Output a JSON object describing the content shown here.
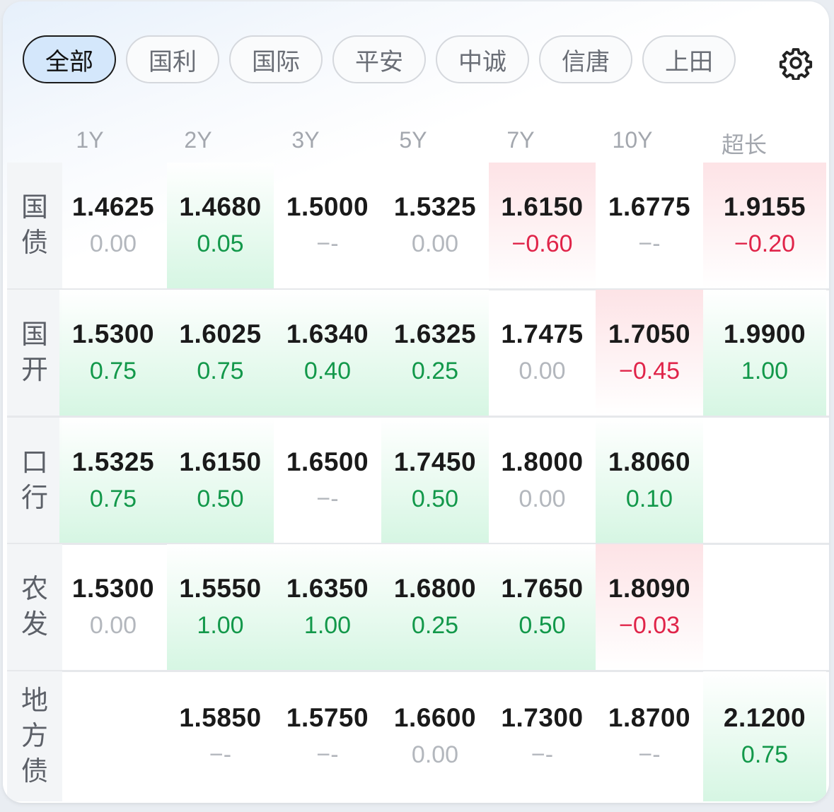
{
  "tabs": [
    {
      "label": "全部",
      "active": true,
      "name": "tab-all"
    },
    {
      "label": "国利",
      "active": false,
      "name": "tab-guoli"
    },
    {
      "label": "国际",
      "active": false,
      "name": "tab-guoji"
    },
    {
      "label": "平安",
      "active": false,
      "name": "tab-pingan"
    },
    {
      "label": "中诚",
      "active": false,
      "name": "tab-zhongcheng"
    },
    {
      "label": "信唐",
      "active": false,
      "name": "tab-xintang"
    },
    {
      "label": "上田",
      "active": false,
      "name": "tab-shangtian"
    }
  ],
  "settings_icon": "gear-icon",
  "columns": [
    "1Y",
    "2Y",
    "3Y",
    "5Y",
    "7Y",
    "10Y",
    "超长"
  ],
  "colors": {
    "up": "#12984a",
    "down": "#e02449",
    "flat": "#b3b7bd",
    "up_bg": "#d6f6e3",
    "down_bg": "#fde3e6"
  },
  "rows": [
    {
      "label": "国债",
      "cells": [
        {
          "yield": "1.4625",
          "change": "0.00",
          "dir": "flat"
        },
        {
          "yield": "1.4680",
          "change": "0.05",
          "dir": "up"
        },
        {
          "yield": "1.5000",
          "change": "--",
          "dir": "flat"
        },
        {
          "yield": "1.5325",
          "change": "0.00",
          "dir": "flat"
        },
        {
          "yield": "1.6150",
          "change": "-0.60",
          "dir": "down"
        },
        {
          "yield": "1.6775",
          "change": "--",
          "dir": "flat"
        },
        {
          "yield": "1.9155",
          "change": "-0.20",
          "dir": "down"
        }
      ]
    },
    {
      "label": "国开",
      "cells": [
        {
          "yield": "1.5300",
          "change": "0.75",
          "dir": "up"
        },
        {
          "yield": "1.6025",
          "change": "0.75",
          "dir": "up"
        },
        {
          "yield": "1.6340",
          "change": "0.40",
          "dir": "up"
        },
        {
          "yield": "1.6325",
          "change": "0.25",
          "dir": "up"
        },
        {
          "yield": "1.7475",
          "change": "0.00",
          "dir": "flat"
        },
        {
          "yield": "1.7050",
          "change": "-0.45",
          "dir": "down"
        },
        {
          "yield": "1.9900",
          "change": "1.00",
          "dir": "up"
        }
      ]
    },
    {
      "label": "口行",
      "cells": [
        {
          "yield": "1.5325",
          "change": "0.75",
          "dir": "up"
        },
        {
          "yield": "1.6150",
          "change": "0.50",
          "dir": "up"
        },
        {
          "yield": "1.6500",
          "change": "--",
          "dir": "flat"
        },
        {
          "yield": "1.7450",
          "change": "0.50",
          "dir": "up"
        },
        {
          "yield": "1.8000",
          "change": "0.00",
          "dir": "flat"
        },
        {
          "yield": "1.8060",
          "change": "0.10",
          "dir": "up"
        },
        null
      ]
    },
    {
      "label": "农发",
      "cells": [
        {
          "yield": "1.5300",
          "change": "0.00",
          "dir": "flat"
        },
        {
          "yield": "1.5550",
          "change": "1.00",
          "dir": "up"
        },
        {
          "yield": "1.6350",
          "change": "1.00",
          "dir": "up"
        },
        {
          "yield": "1.6800",
          "change": "0.25",
          "dir": "up"
        },
        {
          "yield": "1.7650",
          "change": "0.50",
          "dir": "up"
        },
        {
          "yield": "1.8090",
          "change": "-0.03",
          "dir": "down"
        },
        null
      ]
    },
    {
      "label": "地方债",
      "cells": [
        null,
        {
          "yield": "1.5850",
          "change": "--",
          "dir": "flat"
        },
        {
          "yield": "1.5750",
          "change": "--",
          "dir": "flat"
        },
        {
          "yield": "1.6600",
          "change": "0.00",
          "dir": "flat"
        },
        {
          "yield": "1.7300",
          "change": "--",
          "dir": "flat"
        },
        {
          "yield": "1.8700",
          "change": "--",
          "dir": "flat"
        },
        {
          "yield": "2.1200",
          "change": "0.75",
          "dir": "up"
        }
      ]
    }
  ]
}
